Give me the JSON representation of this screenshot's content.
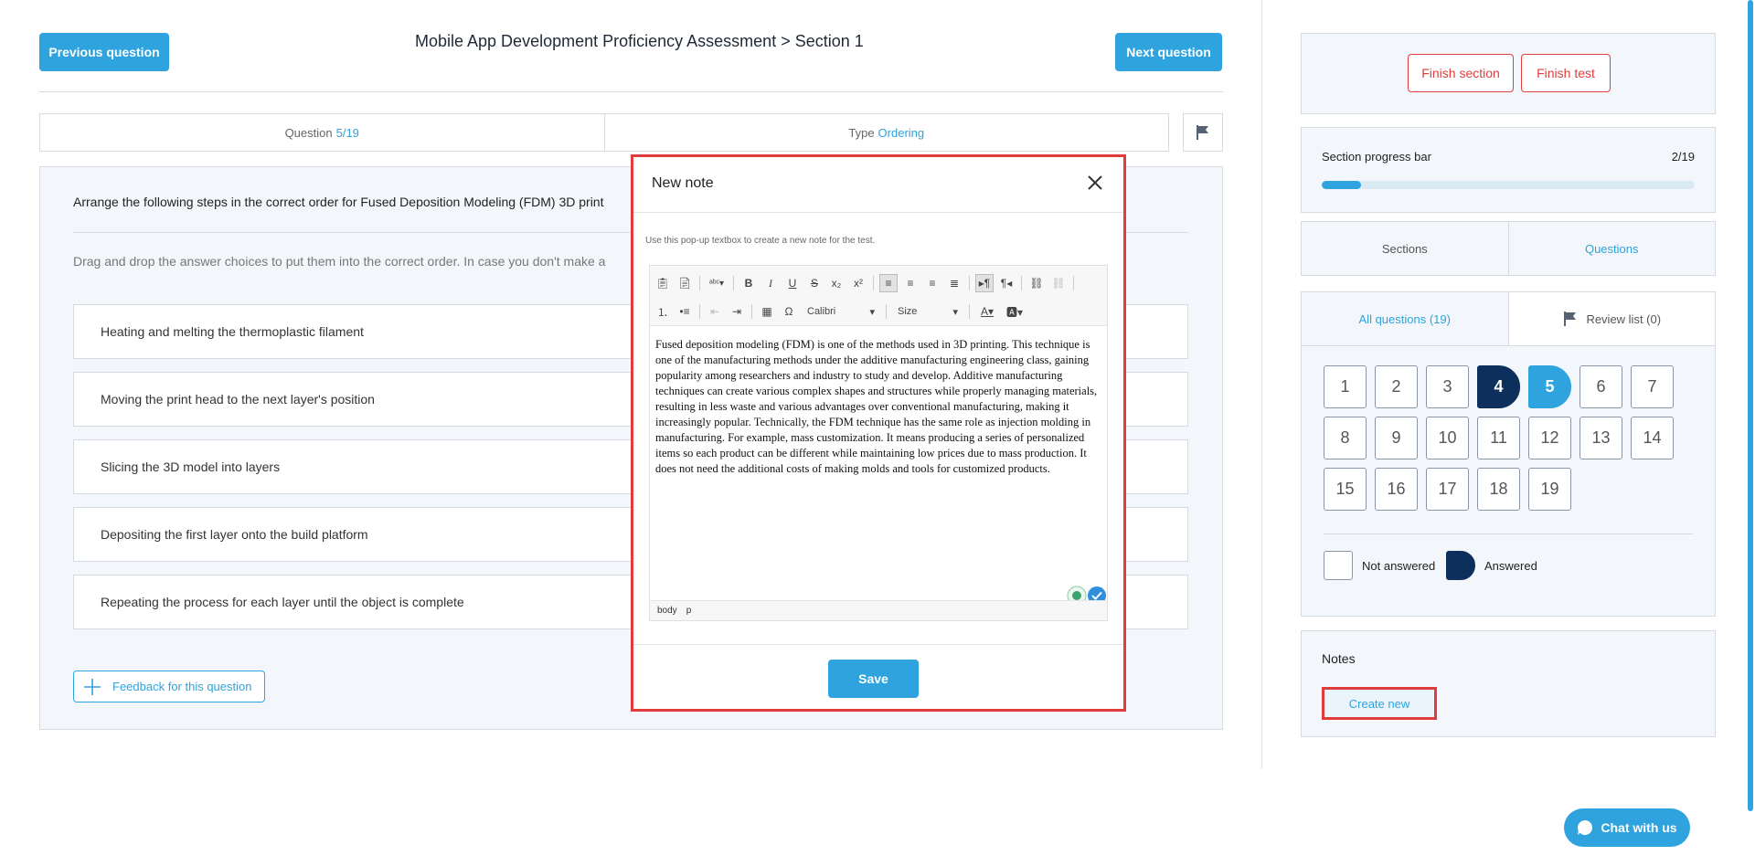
{
  "header": {
    "prev_label": "Previous question",
    "next_label": "Next question",
    "title": "Mobile App Development Proficiency Assessment > Section 1"
  },
  "info": {
    "question_label": "Question",
    "question_value": "5/19",
    "type_label": "Type",
    "type_value": "Ordering"
  },
  "question": {
    "text": "Arrange the following steps in the correct order for Fused Deposition Modeling (FDM) 3D print",
    "instruction": "Drag and drop the answer choices to put them into the correct order. In case you don't make a",
    "choices": [
      "Heating and melting the thermoplastic filament",
      "Moving the print head to the next layer's position",
      "Slicing the 3D model into layers",
      "Depositing the first layer onto the build platform",
      "Repeating the process for each layer until the object is complete"
    ],
    "feedback_label": "Feedback for this question"
  },
  "modal": {
    "title": "New note",
    "hint": "Use this pop-up textbox to create a new note for the test.",
    "font_select": "Calibri",
    "size_select": "Size",
    "body": "Fused deposition modeling (FDM) is one of the methods used in 3D printing. This technique is one of the manufacturing methods under the additive manufacturing engineering class, gaining popularity among researchers and industry to study and develop. Additive manufacturing techniques can create various complex shapes and structures while properly managing materials, resulting in less waste and various advantages over conventional manufacturing, making it increasingly popular. Technically, the FDM technique has the same role as injection molding in manufacturing. For example, mass customization. It means producing a series of personalized items so each product can be different while maintaining low prices due to mass production. It does not need the additional costs of making molds and tools for customized products.",
    "path_body": "body",
    "path_p": "p",
    "save_label": "Save"
  },
  "sidebar": {
    "finish_section": "Finish section",
    "finish_test": "Finish test",
    "progress_label": "Section progress bar",
    "progress_count": "2/19",
    "progress_fraction": 0.105,
    "tab_sections": "Sections",
    "tab_questions": "Questions",
    "tab_all": "All questions (19)",
    "tab_review": "Review list (0)",
    "questions": [
      {
        "n": "1",
        "state": "none"
      },
      {
        "n": "2",
        "state": "none"
      },
      {
        "n": "3",
        "state": "none"
      },
      {
        "n": "4",
        "state": "answered"
      },
      {
        "n": "5",
        "state": "current"
      },
      {
        "n": "6",
        "state": "none"
      },
      {
        "n": "7",
        "state": "none"
      },
      {
        "n": "8",
        "state": "none"
      },
      {
        "n": "9",
        "state": "none"
      },
      {
        "n": "10",
        "state": "none"
      },
      {
        "n": "11",
        "state": "none"
      },
      {
        "n": "12",
        "state": "none"
      },
      {
        "n": "13",
        "state": "none"
      },
      {
        "n": "14",
        "state": "none"
      },
      {
        "n": "15",
        "state": "none"
      },
      {
        "n": "16",
        "state": "none"
      },
      {
        "n": "17",
        "state": "none"
      },
      {
        "n": "18",
        "state": "none"
      },
      {
        "n": "19",
        "state": "none"
      }
    ],
    "legend_not_answered": "Not answered",
    "legend_answered": "Answered",
    "notes_title": "Notes",
    "create_new": "Create new"
  },
  "chat": {
    "label": "Chat with us"
  },
  "colors": {
    "accent": "#2ea3dd",
    "answered": "#0d2f5c",
    "danger": "#e03c3c"
  }
}
